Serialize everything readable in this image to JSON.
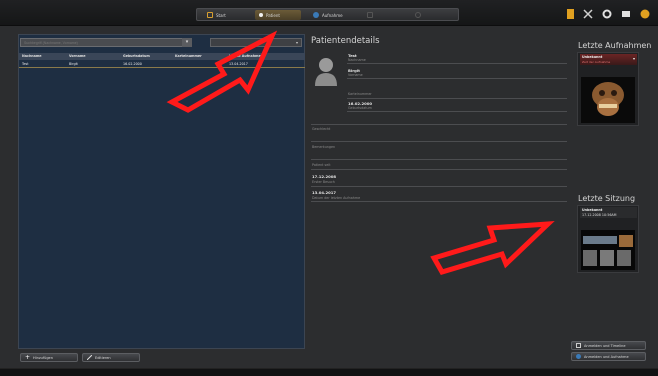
{
  "nav": {
    "tabs": [
      {
        "label": "Start"
      },
      {
        "label": "Patient"
      },
      {
        "label": "Aufnahme"
      }
    ]
  },
  "list": {
    "search_placeholder": "Suchbegriff (Nachname, Vorname)",
    "columns": [
      "Nachname",
      "Vorname",
      "Geburtsdatum",
      "Karteinummer",
      "Letzte Aufnahme"
    ],
    "rows": [
      {
        "nachname": "Test",
        "vorname": "Birgit",
        "geburtsdatum": "16.02.2000",
        "karteinummer": "",
        "letzte_aufnahme": "13.04.2017"
      }
    ]
  },
  "details": {
    "title": "Patientendetails",
    "nachname_value": "Test",
    "nachname_label": "Nachname",
    "vorname_value": "Birgit",
    "vorname_label": "Vorname",
    "karteinummer_label": "Karteinummer",
    "geburtsdatum_value": "16.02.2000",
    "geburtsdatum_label": "Geburtsdatum",
    "geschlecht_label": "Geschlecht",
    "bemerkungen_label": "Bemerkungen",
    "patient_seit_label": "Patient seit",
    "patient_seit_value": "17.12.2008",
    "erster_besuch_label": "Erster Besuch",
    "letzte_aufnahme_value": "13.04.2017",
    "letzte_aufnahme_label": "Datum der letzten Aufnahme"
  },
  "side": {
    "aufnahmen_title": "Letzte Aufnahmen",
    "aufnahmen_head": "Unbekannt",
    "aufnahmen_sub": "Zeit der Aufnahme",
    "sitzung_title": "Letzte Sitzung",
    "sitzung_head": "Unbekannt",
    "sitzung_date": "17.12.2008 10:56AM"
  },
  "buttons": {
    "add": "Hinzufügen",
    "edit": "Editieren",
    "timeline": "Anmelden und Timeline",
    "aufnahme": "Anmelden und Aufnahme"
  },
  "colors": {
    "accent": "#d8a030",
    "arrow": "#ff1a1a",
    "list_bg": "#1e2e42"
  }
}
